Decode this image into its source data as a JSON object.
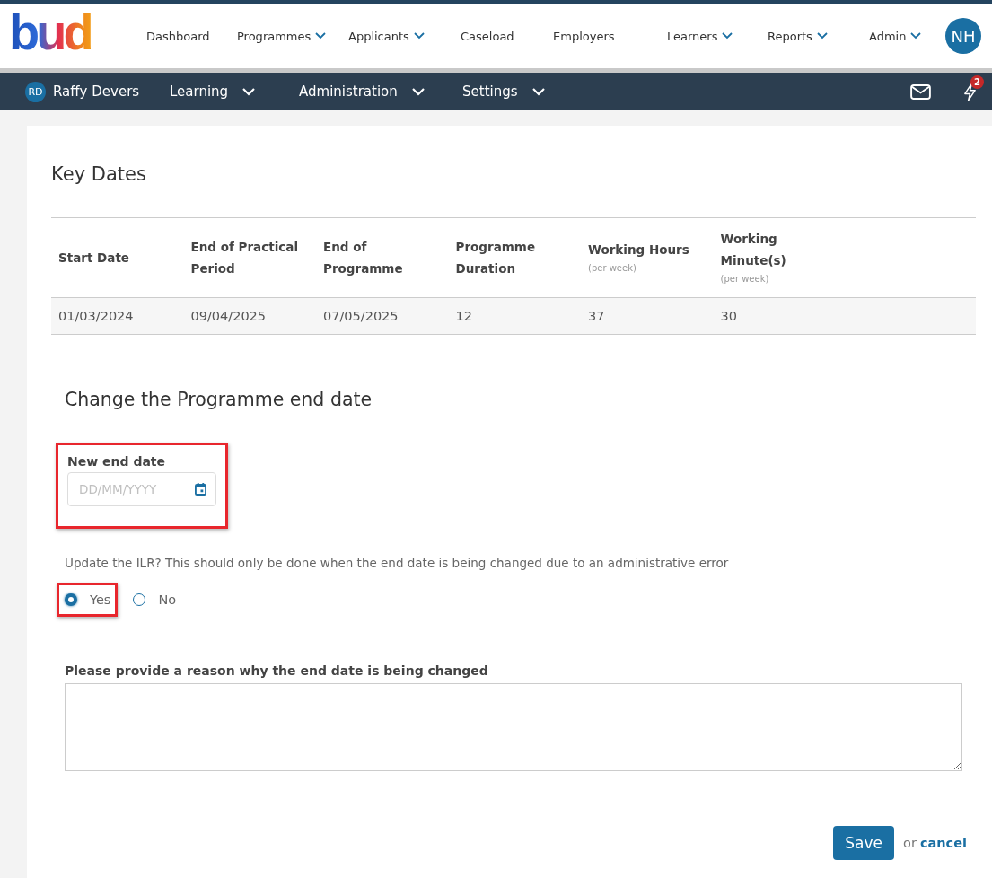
{
  "logo": "bud",
  "top_nav": [
    {
      "label": "Dashboard",
      "dropdown": false
    },
    {
      "label": "Programmes",
      "dropdown": true
    },
    {
      "label": "Applicants",
      "dropdown": true
    },
    {
      "label": "Caseload",
      "dropdown": false
    },
    {
      "label": "Employers",
      "dropdown": false
    },
    {
      "label": "Learners",
      "dropdown": true
    },
    {
      "label": "Reports",
      "dropdown": true
    },
    {
      "label": "Admin",
      "dropdown": true
    }
  ],
  "user_avatar": "NH",
  "learner_bar": {
    "initials": "RD",
    "name": "Raffy Devers",
    "menus": [
      "Learning",
      "Administration",
      "Settings"
    ],
    "notification_count": "2"
  },
  "key_dates": {
    "title": "Key Dates",
    "columns": [
      {
        "label": "Start Date"
      },
      {
        "label": "End of Practical Period"
      },
      {
        "label": "End of Programme"
      },
      {
        "label": "Programme Duration"
      },
      {
        "label": "Working Hours",
        "note": "(per week)"
      },
      {
        "label": "Working Minute(s)",
        "note": "(per week)"
      }
    ],
    "row": [
      "01/03/2024",
      "09/04/2025",
      "07/05/2025",
      "12",
      "37",
      "30"
    ]
  },
  "change_form": {
    "title": "Change the Programme end date",
    "date_field": {
      "label": "New end date",
      "placeholder": "DD/MM/YYYY",
      "highlighted": true
    },
    "ilr_question": "Update the ILR? This should only be done when the end date is being changed due to an administrative error",
    "options": [
      {
        "label": "Yes",
        "selected": true,
        "highlighted": true
      },
      {
        "label": "No",
        "selected": false,
        "highlighted": false
      }
    ],
    "reason_label": "Please provide a reason why the end date is being changed",
    "save": "Save",
    "or": "or",
    "cancel": "cancel"
  }
}
